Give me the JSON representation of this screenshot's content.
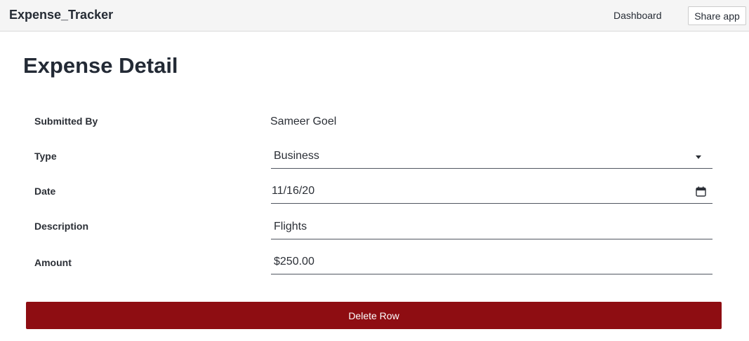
{
  "header": {
    "app_title": "Expense_Tracker",
    "nav_dashboard": "Dashboard",
    "share_label": "Share app"
  },
  "page": {
    "title": "Expense Detail"
  },
  "form": {
    "submitted_by": {
      "label": "Submitted By",
      "value": "Sameer Goel"
    },
    "type": {
      "label": "Type",
      "value": "Business"
    },
    "date": {
      "label": "Date",
      "value": "11/16/20"
    },
    "description": {
      "label": "Description",
      "value": "Flights"
    },
    "amount": {
      "label": "Amount",
      "value": "$250.00"
    }
  },
  "actions": {
    "delete_label": "Delete Row"
  },
  "colors": {
    "delete_button": "#8e0d12",
    "header_bg": "#f5f5f5"
  }
}
